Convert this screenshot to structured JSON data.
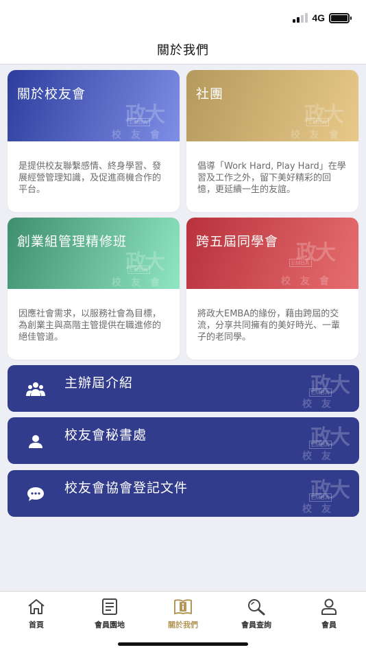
{
  "status_bar": {
    "network": "4G"
  },
  "header": {
    "title": "關於我們"
  },
  "cards": [
    {
      "title": "關於校友會",
      "description": "是提供校友聯繫感情、終身學習、發展經營管理知識，及促進商機合作的平台。",
      "color": "#4a5cc7"
    },
    {
      "title": "社團",
      "description": "倡導「Work Hard, Play Hard」在學習及工作之外，留下美好精彩的回憶，更延續一生的友誼。",
      "color": "#cfb274"
    },
    {
      "title": "創業組管理精修班",
      "description": "因應社會需求，以服務社會為目標，為創業主與高階主管提供在職進修的絕佳管道。",
      "color": "#5fb68e"
    },
    {
      "title": "跨五屆同學會",
      "description": "將政大EMBA的緣份，藉由跨屆的交流，分享共同擁有的美好時光、一輩子的老同學。",
      "color": "#cf4a50"
    }
  ],
  "watermark": {
    "main": "政大",
    "emba": "EMBA",
    "sub": "校友會"
  },
  "list_buttons": [
    {
      "label": "主辦屆介紹",
      "icon": "group-icon"
    },
    {
      "label": "校友會秘書處",
      "icon": "person-icon"
    },
    {
      "label": "校友會協會登記文件",
      "icon": "chat-bubble-icon"
    }
  ],
  "tabs": [
    {
      "label": "首頁",
      "icon": "home-icon",
      "active": false
    },
    {
      "label": "會員園地",
      "icon": "document-icon",
      "active": false
    },
    {
      "label": "關於我們",
      "icon": "info-book-icon",
      "active": true
    },
    {
      "label": "會員查詢",
      "icon": "search-icon",
      "active": false
    },
    {
      "label": "會員",
      "icon": "user-icon",
      "active": false
    }
  ],
  "colors": {
    "accent": "#b39659",
    "list_button": "#323c8c"
  }
}
